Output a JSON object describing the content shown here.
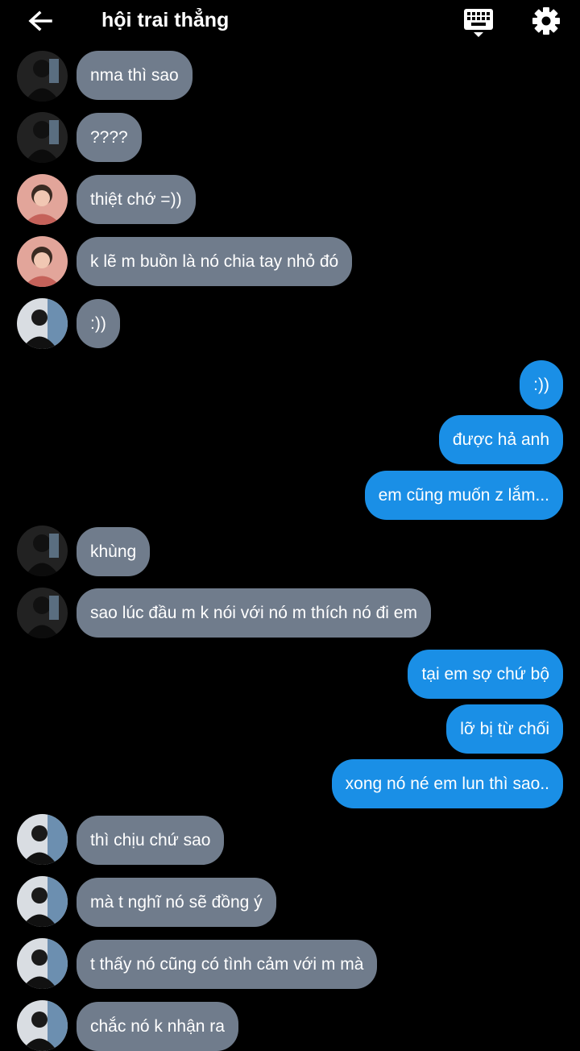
{
  "header": {
    "title": "hội trai thẳng",
    "back_icon": "arrow-left-icon",
    "keyboard_icon": "keyboard-icon",
    "settings_icon": "gear-icon"
  },
  "colors": {
    "background": "#000000",
    "incoming_bubble": "#707c8c",
    "outgoing_bubble": "#1a8fe6"
  },
  "messages": [
    {
      "from": "in",
      "avatar": "dark",
      "text": "nma thì sao"
    },
    {
      "from": "in",
      "avatar": "dark",
      "text": "????"
    },
    {
      "from": "in",
      "avatar": "pink",
      "text": "thiệt chớ =))"
    },
    {
      "from": "in",
      "avatar": "pink",
      "text": "k lẽ m buồn là nó chia tay nhỏ đó"
    },
    {
      "from": "in",
      "avatar": "light",
      "text": ":))"
    },
    {
      "from": "out",
      "text": ":))"
    },
    {
      "from": "out",
      "text": "được hả anh"
    },
    {
      "from": "out",
      "text": "em cũng muốn z lắm..."
    },
    {
      "from": "in",
      "avatar": "dark",
      "text": "khùng"
    },
    {
      "from": "in",
      "avatar": "dark",
      "text": "sao lúc đầu m k nói với nó m thích nó đi em"
    },
    {
      "from": "out",
      "text": "tại em sợ chứ bộ"
    },
    {
      "from": "out",
      "text": "lỡ bị từ chối"
    },
    {
      "from": "out",
      "text": "xong nó né em lun thì sao.."
    },
    {
      "from": "in",
      "avatar": "light",
      "text": "thì chịu chứ sao"
    },
    {
      "from": "in",
      "avatar": "light",
      "text": "mà t nghĩ nó sẽ đồng ý"
    },
    {
      "from": "in",
      "avatar": "light",
      "text": "t thấy nó cũng có tình cảm với m mà"
    },
    {
      "from": "in",
      "avatar": "light",
      "text": "chắc nó k nhận ra"
    }
  ]
}
